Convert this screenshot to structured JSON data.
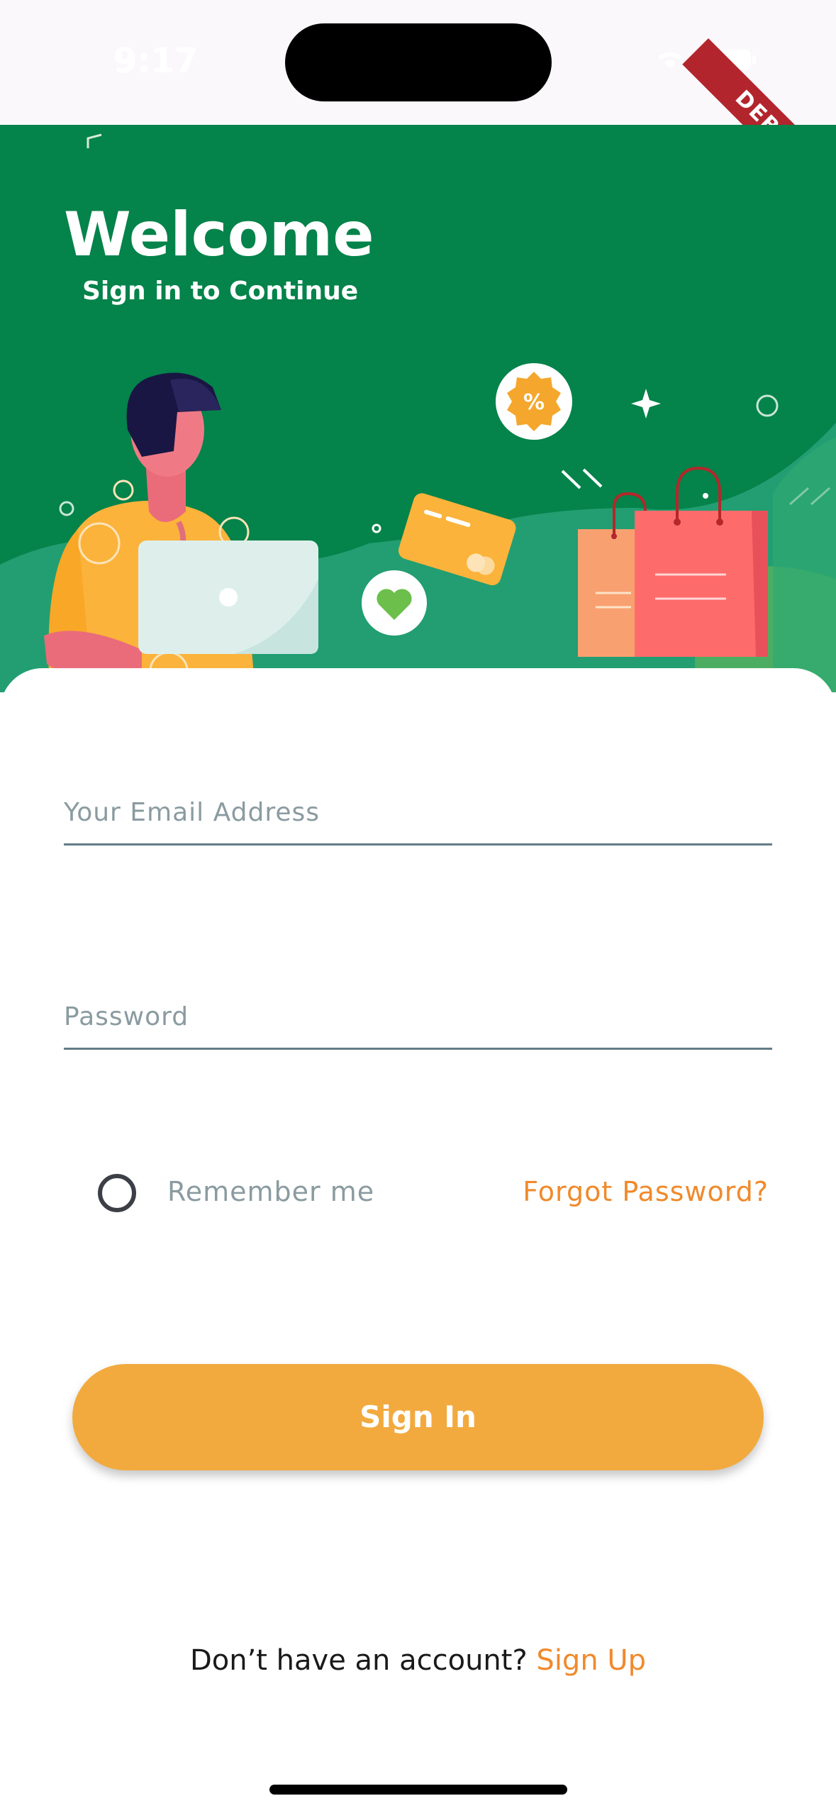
{
  "status_bar": {
    "time": "9:17",
    "debug_label": "DEBUG",
    "icons": [
      "signal-icon",
      "wifi-icon",
      "battery-icon"
    ]
  },
  "hero": {
    "title": "Welcome",
    "subtitle": "Sign in to Continue",
    "background_color": "#04834a",
    "discount_badge": "%"
  },
  "form": {
    "email_placeholder": "Your Email Address",
    "password_placeholder": "Password",
    "remember_label": "Remember me",
    "forgot_label": "Forgot Password?",
    "signin_label": "Sign In",
    "signup_prompt": "Don’t have an account?",
    "signup_link": "Sign Up"
  },
  "colors": {
    "accent": "#f2aa3e",
    "link": "#f08a2c",
    "primary_green": "#04834a"
  }
}
